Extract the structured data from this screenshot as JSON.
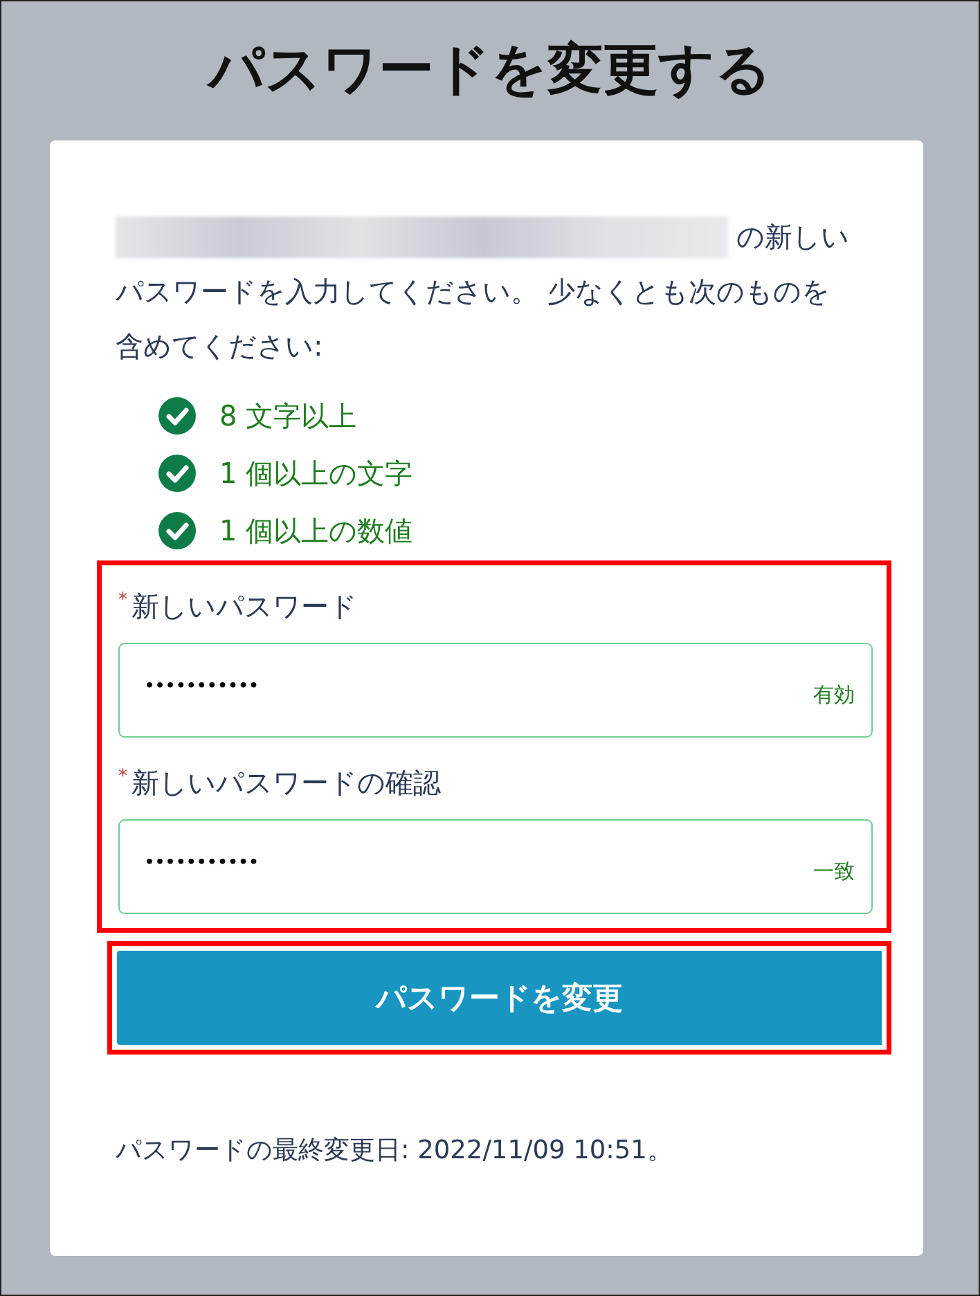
{
  "title": "パスワードを変更する",
  "intro": {
    "redacted": true,
    "lead": "の新しい",
    "text": "パスワードを入力してください。 少なくとも次のものを含めてください:"
  },
  "requirements": [
    {
      "label": "8 文字以上",
      "met": true
    },
    {
      "label": "1 個以上の文字",
      "met": true
    },
    {
      "label": "1 個以上の数値",
      "met": true
    }
  ],
  "fields": [
    {
      "label": "新しいパスワード",
      "required_mark": "*",
      "value": "•••••••••••",
      "status": "有効",
      "valid": true
    },
    {
      "label": "新しいパスワードの確認",
      "required_mark": "*",
      "value": "•••••••••••",
      "status": "一致",
      "valid": true
    }
  ],
  "highlighted": true,
  "submit_button": "パスワードを変更",
  "last_changed": "パスワードの最終変更日: 2022/11/09 10:51。"
}
